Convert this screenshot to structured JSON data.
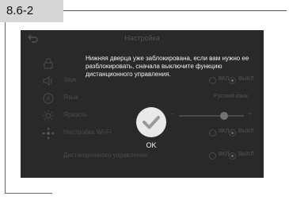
{
  "section": {
    "label": "8.6-2"
  },
  "screen": {
    "title": "Настройка",
    "menu": [
      {
        "icon": "lock-icon",
        "label": ""
      },
      {
        "icon": "speaker-icon",
        "label": "Звук",
        "options": [
          "ВКЛ",
          "ВЫКЛ"
        ],
        "selected": 1
      },
      {
        "icon": "language-icon",
        "label": "Язык",
        "value": "Русский язык"
      },
      {
        "icon": "brightness-icon",
        "label": "Яркость",
        "brightness": 0.7
      },
      {
        "icon": "wifi-icon",
        "label": "Настройка Wi-Fi",
        "options": [
          "ВКЛ",
          "ВЫКЛ"
        ],
        "selected": 1
      },
      {
        "icon": "",
        "label": "Дистанционного управления",
        "options": [
          "ВКЛ",
          "ВЫКЛ"
        ],
        "selected": 1
      }
    ]
  },
  "dialog": {
    "message": "Нижняя дверца уже заблокирована, если вам нужно ее разблокировать, сначала выключите функцию дистанционного управления.",
    "ok_label": "OK"
  },
  "colors": {
    "screen_bg": "#2a2a2a",
    "tab_bg": "#d6d6d6",
    "overlay_text": "#f2f2f2"
  }
}
